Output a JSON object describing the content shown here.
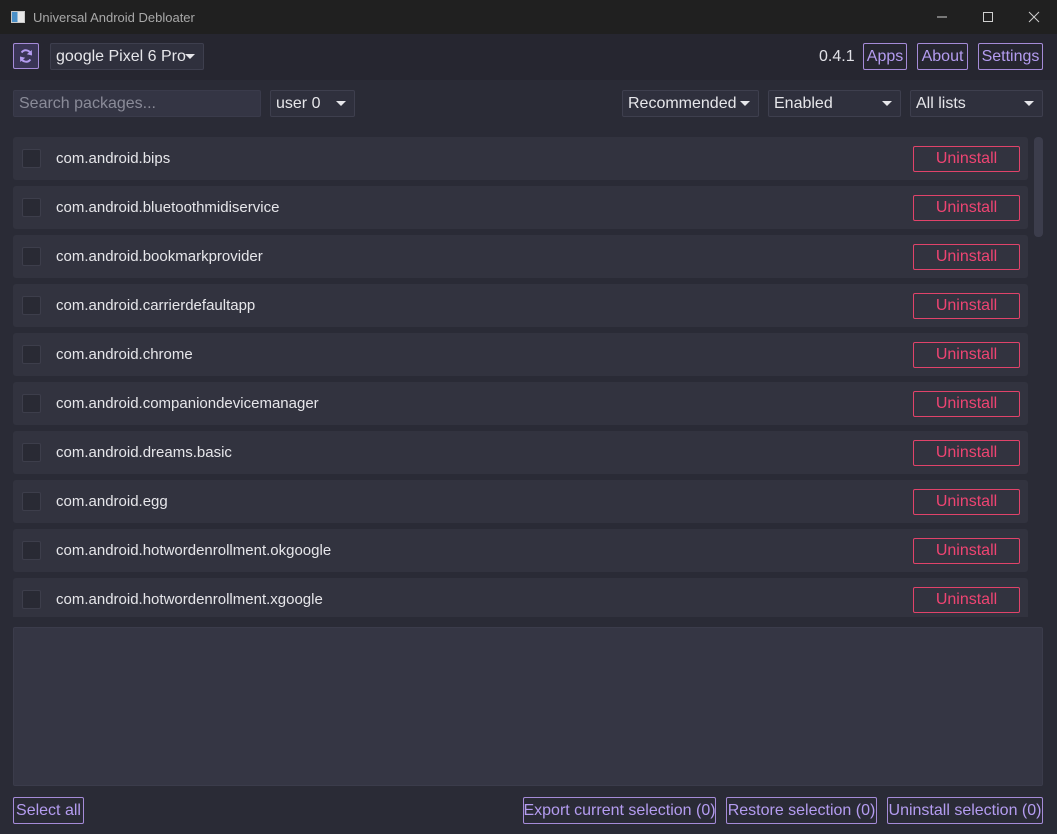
{
  "window": {
    "title": "Universal Android Debloater",
    "app_icon": "app-window-icon",
    "controls": [
      "minimize-icon",
      "maximize-icon",
      "close-icon"
    ]
  },
  "header": {
    "refresh_icon": "refresh-icon",
    "device": "google Pixel 6 Pro",
    "version": "0.4.1",
    "apps_label": "Apps",
    "about_label": "About",
    "settings_label": "Settings"
  },
  "filters": {
    "search_placeholder": "Search packages...",
    "user": "user 0",
    "recommendation": "Recommended",
    "state": "Enabled",
    "list": "All lists"
  },
  "packages": [
    {
      "name": "com.android.bips",
      "action": "Uninstall",
      "checked": false
    },
    {
      "name": "com.android.bluetoothmidiservice",
      "action": "Uninstall",
      "checked": false
    },
    {
      "name": "com.android.bookmarkprovider",
      "action": "Uninstall",
      "checked": false
    },
    {
      "name": "com.android.carrierdefaultapp",
      "action": "Uninstall",
      "checked": false
    },
    {
      "name": "com.android.chrome",
      "action": "Uninstall",
      "checked": false
    },
    {
      "name": "com.android.companiondevicemanager",
      "action": "Uninstall",
      "checked": false
    },
    {
      "name": "com.android.dreams.basic",
      "action": "Uninstall",
      "checked": false
    },
    {
      "name": "com.android.egg",
      "action": "Uninstall",
      "checked": false
    },
    {
      "name": "com.android.hotwordenrollment.okgoogle",
      "action": "Uninstall",
      "checked": false
    },
    {
      "name": "com.android.hotwordenrollment.xgoogle",
      "action": "Uninstall",
      "checked": false
    }
  ],
  "footer": {
    "select_all": "Select all",
    "export": "Export current selection (0)",
    "restore": "Restore selection (0)",
    "uninstall_selection": "Uninstall selection (0)"
  },
  "colors": {
    "accent": "#a58bd8",
    "danger": "#e0436a",
    "background": "#2a2b36"
  }
}
